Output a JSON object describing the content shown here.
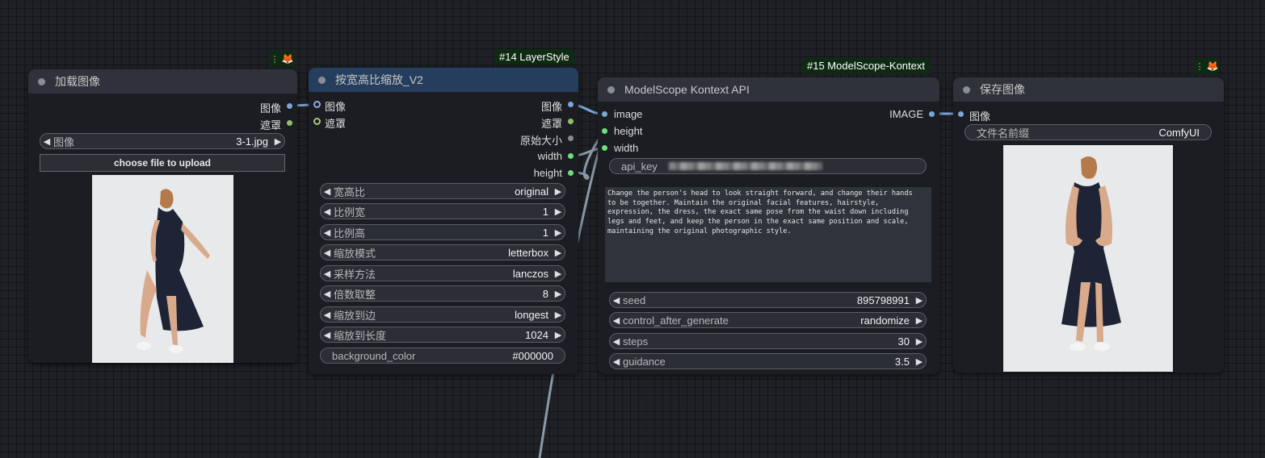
{
  "nodes": {
    "load_image": {
      "title": "加载图像",
      "outputs": [
        "图像",
        "遮罩"
      ],
      "image_widget": {
        "label": "图像",
        "value": "3-1.jpg"
      },
      "upload_button": "choose file to upload"
    },
    "resize": {
      "badge": "#14  LayerStyle",
      "title": "按宽高比缩放_V2",
      "inputs": [
        "图像",
        "遮罩"
      ],
      "outputs": [
        "图像",
        "遮罩",
        "原始大小",
        "width",
        "height"
      ],
      "widgets": [
        {
          "label": "宽高比",
          "value": "original"
        },
        {
          "label": "比例宽",
          "value": "1"
        },
        {
          "label": "比例高",
          "value": "1"
        },
        {
          "label": "缩放模式",
          "value": "letterbox"
        },
        {
          "label": "采样方法",
          "value": "lanczos"
        },
        {
          "label": "倍数取整",
          "value": "8"
        },
        {
          "label": "缩放到边",
          "value": "longest"
        },
        {
          "label": "缩放到长度",
          "value": "1024"
        }
      ],
      "background_color": {
        "label": "background_color",
        "value": "#000000"
      }
    },
    "kontext": {
      "badge": "#15 ModelScope-Kontext",
      "title": "ModelScope Kontext API",
      "inputs": [
        "image",
        "height",
        "width"
      ],
      "output": "IMAGE",
      "api_key_label": "api_key",
      "prompt": "Change the person's head to look straight forward, and change their hands\nto be together. Maintain the original facial features, hairstyle,\nexpression, the dress, the exact same pose from the waist down including\nlegs and feet, and keep the person in the exact same position and scale,\nmaintaining the original photographic style.",
      "widgets": [
        {
          "label": "seed",
          "value": "895798991"
        },
        {
          "label": "control_after_generate",
          "value": "randomize"
        },
        {
          "label": "steps",
          "value": "30"
        },
        {
          "label": "guidance",
          "value": "3.5"
        }
      ]
    },
    "save": {
      "title": "保存图像",
      "input": "图像",
      "filename_prefix": {
        "label": "文件名前缀",
        "value": "ComfyUI"
      }
    }
  },
  "icons": {
    "badge_icon": "fox-icon",
    "menu": "vertical-dots-icon"
  },
  "colors": {
    "image_slot": "#7aa6d8",
    "mask_slot": "#8fbf6a",
    "int_slot": "#6fe07a",
    "badge_bg": "#0f2a12",
    "resize_header": "#253e5e"
  }
}
